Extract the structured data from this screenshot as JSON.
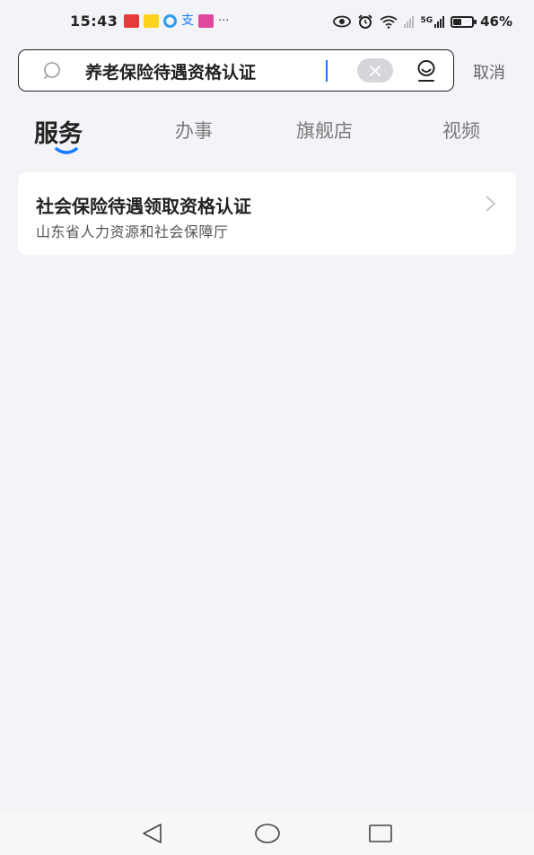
{
  "status_bar": {
    "time": "15:43",
    "more_notifications": "···",
    "alipay_glyph": "支",
    "battery_percent": "46%",
    "battery_level": 0.46,
    "network_type": "5G"
  },
  "search": {
    "query": "养老保险待遇资格认证",
    "cancel_label": "取消",
    "icons": [
      "search-icon",
      "clear-icon",
      "microphone-icon"
    ]
  },
  "tabs": [
    {
      "label": "服务",
      "active": true
    },
    {
      "label": "办事",
      "active": false
    },
    {
      "label": "旗舰店",
      "active": false
    },
    {
      "label": "视频",
      "active": false
    }
  ],
  "results": [
    {
      "title": "社会保险待遇领取资格认证",
      "subtitle": "山东省人力资源和社会保障厅"
    }
  ],
  "navigation": [
    "back-icon",
    "home-icon",
    "recents-icon"
  ],
  "colors": {
    "accent": "#1677ff",
    "background": "#f3f4f8",
    "card": "#ffffff"
  }
}
